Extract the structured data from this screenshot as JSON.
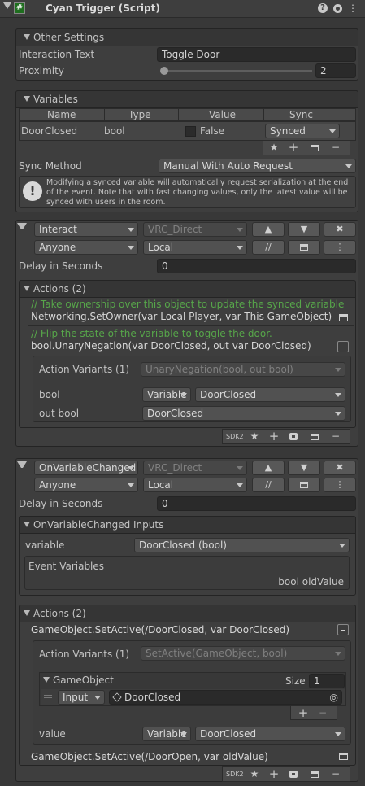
{
  "title": "Cyan Trigger (Script)",
  "other_settings": {
    "header": "Other Settings",
    "interaction_label": "Interaction Text",
    "interaction_value": "Toggle Door",
    "proximity_label": "Proximity",
    "proximity_value": "2"
  },
  "variables": {
    "header": "Variables",
    "col_name": "Name",
    "col_type": "Type",
    "col_value": "Value",
    "col_sync": "Sync",
    "row_name": "DoorClosed",
    "row_type": "bool",
    "row_value": "False",
    "row_sync": "Synced"
  },
  "sync": {
    "label": "Sync Method",
    "value": "Manual With Auto Request",
    "help": "Modifying a synced variable will automatically request serialization at the end of the event. Note that with fast changing values, only the latest value will be synced with users in the room."
  },
  "event1": {
    "event": "Interact",
    "broadcast": "VRC_Direct",
    "target": "Anyone",
    "local": "Local",
    "delay_label": "Delay in Seconds",
    "delay_value": "0",
    "actions_header": "Actions (2)",
    "comment1": "// Take ownership over this object to update the synced variable",
    "action1": "Networking.SetOwner(var Local Player, var This GameObject)",
    "comment2": "// Flip the state of the variable to toggle the door.",
    "action2": "bool.UnaryNegation(var DoorClosed, out var DoorClosed)",
    "variants_label": "Action Variants (1)",
    "variants_value": "UnaryNegation(bool, out bool)",
    "bool_label": "bool",
    "bool_mode": "Variable",
    "bool_var": "DoorClosed",
    "outbool_label": "out bool",
    "outbool_var": "DoorClosed",
    "sdk": "SDK2"
  },
  "event2": {
    "event": "OnVariableChanged",
    "broadcast": "VRC_Direct",
    "target": "Anyone",
    "local": "Local",
    "delay_label": "Delay in Seconds",
    "delay_value": "0",
    "inputs_header": "OnVariableChanged Inputs",
    "variable_label": "variable",
    "variable_value": "DoorClosed (bool)",
    "event_vars_label": "Event Variables",
    "event_vars_value": "bool oldValue",
    "actions_header": "Actions (2)",
    "action1": "GameObject.SetActive(/DoorClosed, var DoorClosed)",
    "variants_label": "Action Variants (1)",
    "variants_value": "SetActive(GameObject, bool)",
    "go_label": "GameObject",
    "size_label": "Size",
    "size_value": "1",
    "input_mode": "Input",
    "go_value": "DoorClosed",
    "value_label": "value",
    "value_mode": "Variable",
    "value_var": "DoorClosed",
    "action2": "GameObject.SetActive(/DoorOpen, var oldValue)",
    "sdk": "SDK2"
  },
  "icons": {
    "comp": "#",
    "help": "?",
    "settings": "⋮",
    "star": "★",
    "plus": "+",
    "minus": "−",
    "up": "▲",
    "down": "▼",
    "close": "✖",
    "comment": "//",
    "more": "⋮",
    "target": "◎"
  }
}
